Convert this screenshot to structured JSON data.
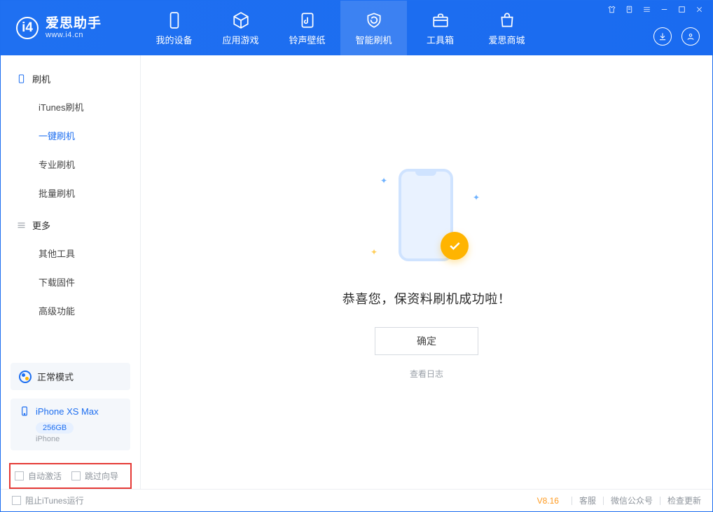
{
  "brand": {
    "title": "爱思助手",
    "subtitle": "www.i4.cn"
  },
  "nav": {
    "device": "我的设备",
    "apps": "应用游戏",
    "rings": "铃声壁纸",
    "flash": "智能刷机",
    "tools": "工具箱",
    "store": "爱思商城"
  },
  "sidebar": {
    "g1": "刷机",
    "g1_items": {
      "itunes": "iTunes刷机",
      "oneclick": "一键刷机",
      "pro": "专业刷机",
      "batch": "批量刷机"
    },
    "g2": "更多",
    "g2_items": {
      "other": "其他工具",
      "firmware": "下载固件",
      "adv": "高级功能"
    }
  },
  "mode": {
    "label": "正常模式"
  },
  "device": {
    "name": "iPhone XS Max",
    "capacity": "256GB",
    "type": "iPhone"
  },
  "options": {
    "auto_activate": "自动激活",
    "skip_guide": "跳过向导"
  },
  "result": {
    "message": "恭喜您，保资料刷机成功啦！",
    "ok": "确定",
    "view_log": "查看日志"
  },
  "status": {
    "block_itunes": "阻止iTunes运行",
    "version": "V8.16",
    "support": "客服",
    "wechat": "微信公众号",
    "update": "检查更新"
  }
}
